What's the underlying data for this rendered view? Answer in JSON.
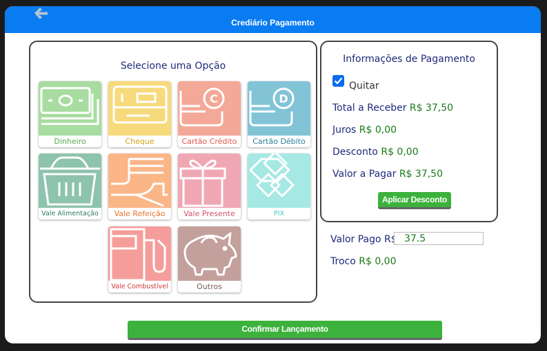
{
  "header": {
    "title": "Crediário Pagamento"
  },
  "options_panel": {
    "title": "Selecione uma Opção",
    "tiles": [
      {
        "label": "Dinheiro",
        "icon": "cash-icon",
        "bg": "#a8dca0",
        "fg": "#55a84e"
      },
      {
        "label": "Cheque",
        "icon": "check-icon",
        "bg": "#f7da7c",
        "fg": "#d4a414"
      },
      {
        "label": "Cartão Crédito",
        "icon": "credit-card-icon",
        "bg": "#f4a898",
        "fg": "#d9584a"
      },
      {
        "label": "Cartão Débito",
        "icon": "debit-card-icon",
        "bg": "#82c4d6",
        "fg": "#2b7f9b"
      },
      {
        "label": "Vale Alimentação",
        "icon": "basket-icon",
        "bg": "#8ec3ae",
        "fg": "#2e7a5e"
      },
      {
        "label": "Vale Refeição",
        "icon": "fork-knife-icon",
        "bg": "#fbb688",
        "fg": "#e8742c"
      },
      {
        "label": "Vale Presente",
        "icon": "gift-icon",
        "bg": "#f0a7b4",
        "fg": "#d4526c"
      },
      {
        "label": "PIX",
        "icon": "pix-icon",
        "bg": "#a6e8e4",
        "fg": "#46c6bf"
      },
      {
        "label": "Vale Combustível",
        "icon": "fuel-pump-icon",
        "bg": "#f59d9a",
        "fg": "#cc3a35"
      },
      {
        "label": "Outros",
        "icon": "piggy-bank-icon",
        "bg": "#c3a09c",
        "fg": "#7c5a56"
      }
    ]
  },
  "payment_info": {
    "title": "Informações de Pagamento",
    "quitar_label": "Quitar",
    "quitar_checked": true,
    "total_label": "Total a Receber",
    "total_value": "R$ 37,50",
    "juros_label": "Juros",
    "juros_value": "R$ 0,00",
    "desconto_label": "Desconto",
    "desconto_value": "R$ 0,00",
    "valor_pagar_label": "Valor a Pagar",
    "valor_pagar_value": "R$ 37,50",
    "apply_discount_button": "Aplicar Desconto"
  },
  "payment": {
    "valor_pago_label": "Valor Pago R$",
    "valor_pago_value": "37.5",
    "troco_label": "Troco",
    "troco_value": "R$ 0,00"
  },
  "confirm_button": "Confirmar Lançamento",
  "colors": {
    "header": "#0a7cf2",
    "button_green": "#3cb23c",
    "text_blue": "#1e2a7a",
    "value_green": "#1a7a1a"
  }
}
